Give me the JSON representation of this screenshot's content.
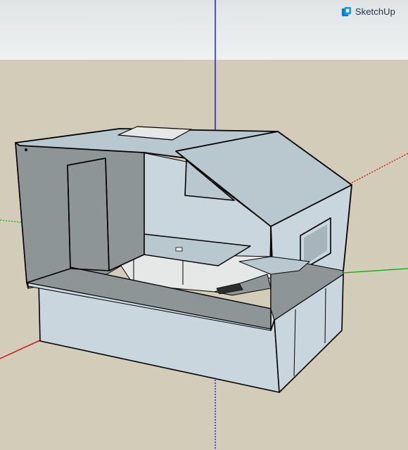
{
  "app": {
    "brand_name": "SketchUp",
    "logo_icon": "sketchup-logo-icon"
  },
  "viewport": {
    "sky_color_top": "#dfe4e5",
    "sky_color_bottom": "#eef1f1",
    "ground_color": "#d2ccb8",
    "axis_colors": {
      "red": "#d10000",
      "green": "#00b000",
      "blue": "#0000d8"
    }
  },
  "model": {
    "face_front_color": "#c9d6de",
    "face_side_color": "#b9c7cf",
    "face_back_color": "#8e9596",
    "face_light_color": "#e6e8e8",
    "edge_color": "#000000"
  }
}
